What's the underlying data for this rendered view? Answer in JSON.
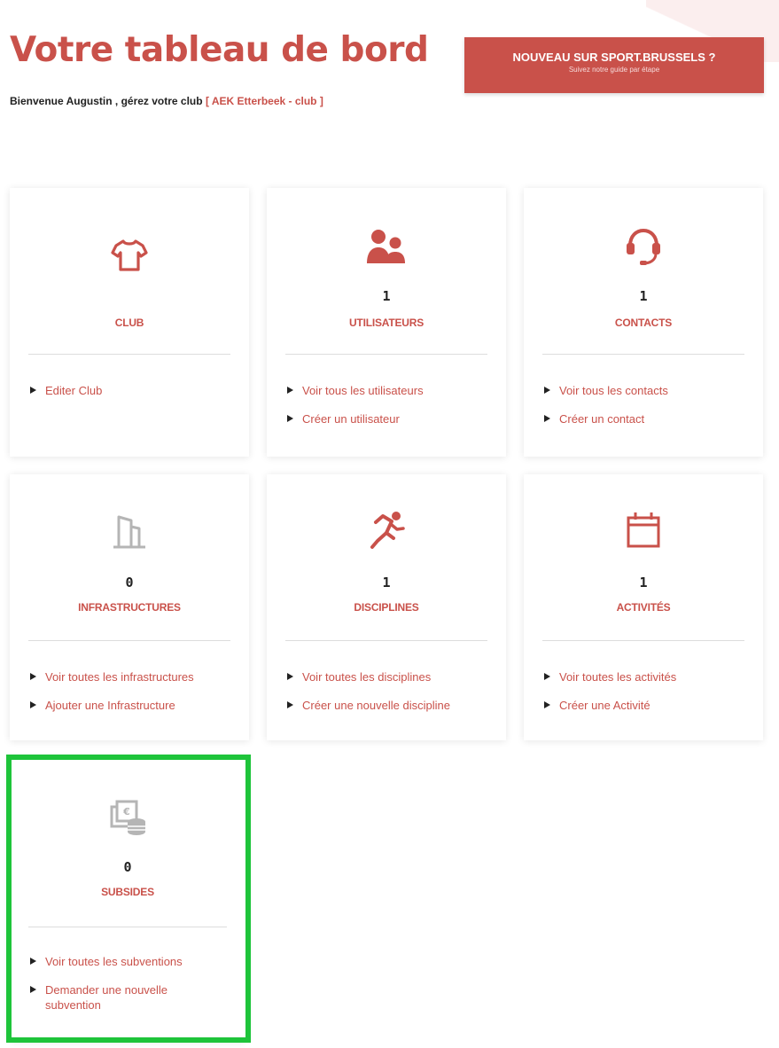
{
  "header": {
    "title": "Votre tableau de bord",
    "welcome_prefix": "Bienvenue Augustin , gérez votre club ",
    "club_link": "[ AEK Etterbeek - club ]"
  },
  "guide": {
    "title": "NOUVEAU SUR SPORT.BRUSSELS ?",
    "subtitle": "Suivez notre guide par étape"
  },
  "colors": {
    "accent": "#c9514a",
    "highlight": "#1ec43a",
    "muted_icon": "#b5b5b5"
  },
  "cards": {
    "club": {
      "icon": "tshirt-icon",
      "count": "",
      "label": "CLUB",
      "links": [
        "Editer Club"
      ]
    },
    "users": {
      "icon": "users-icon",
      "count": "1",
      "label": "UTILISATEURS",
      "links": [
        "Voir tous les utilisateurs",
        "Créer un utilisateur"
      ]
    },
    "contacts": {
      "icon": "headset-icon",
      "count": "1",
      "label": "CONTACTS",
      "links": [
        "Voir tous les contacts",
        "Créer un contact"
      ]
    },
    "infrastructures": {
      "icon": "building-icon",
      "count": "0",
      "label": "INFRASTRUCTURES",
      "links": [
        "Voir toutes les infrastructures",
        "Ajouter une Infrastructure"
      ]
    },
    "disciplines": {
      "icon": "runner-icon",
      "count": "1",
      "label": "DISCIPLINES",
      "links": [
        "Voir toutes les disciplines",
        "Créer une nouvelle discipline"
      ]
    },
    "activities": {
      "icon": "calendar-icon",
      "count": "1",
      "label": "ACTIVITÉS",
      "links": [
        "Voir toutes les activités",
        "Créer une Activité"
      ]
    },
    "subsidies": {
      "icon": "money-coins-icon",
      "count": "0",
      "label": "SUBSIDES",
      "links": [
        "Voir toutes les subventions",
        "Demander une nouvelle subvention"
      ]
    }
  }
}
